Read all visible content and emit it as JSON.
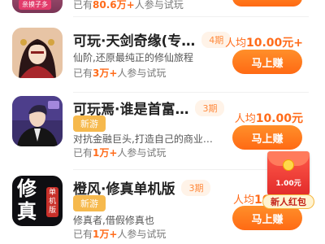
{
  "colors": {
    "accent": "#ff6b1a",
    "button": "#ff7a1f",
    "tag_new": "#f6b94d"
  },
  "top_partial": {
    "stat_prefix": "已有",
    "stat_count": "80.6万+",
    "stat_suffix": "人参与试玩",
    "badge_text": "亲摸子多"
  },
  "games": [
    {
      "name": "可玩·天剑奇缘(专…",
      "period": "4期",
      "desc": "仙阶,还原最纯正的修仙旅程",
      "stat_prefix": "已有",
      "stat_count": "3万+",
      "stat_suffix": "人参与试玩",
      "reward_prefix": "人均",
      "reward_amount": "10.00元+",
      "button": "马上赚",
      "icon": "xianxia-portrait-icon"
    },
    {
      "name": "可玩焉·谁是首富…",
      "period": "3期",
      "tag": "新游",
      "desc": "对抗金融巨头,打造自己的商业…",
      "stat_prefix": "已有",
      "stat_count": "1万+",
      "stat_suffix": "人参与试玩",
      "reward_prefix": "人均",
      "reward_amount": "10.00元",
      "button": "马上赚",
      "icon": "businessman-portrait-icon"
    },
    {
      "name": "橙风·修真单机版",
      "period": "3期",
      "tag": "新游",
      "desc": "修真者,借假修真也",
      "stat_prefix": "已有",
      "stat_count": "1万+",
      "stat_suffix": "人参与试玩",
      "reward_prefix": "人均",
      "reward_amount": "10",
      "button": "马上赚",
      "icon": "xiuzhen-calligraphy-icon",
      "icon_text": "修真",
      "icon_badge": "单机版"
    }
  ],
  "floating_redpack": {
    "amount": "1.00元",
    "label": "新人红包"
  }
}
